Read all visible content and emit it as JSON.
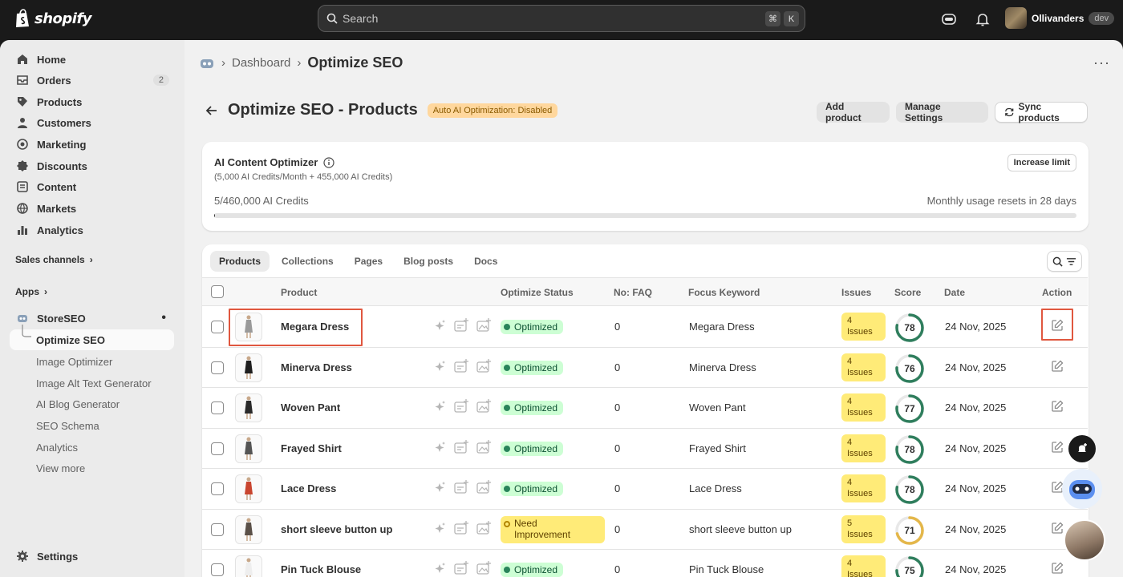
{
  "topbar": {
    "brand": "shopify",
    "search_placeholder": "Search",
    "shortcut_keys": [
      "⌘",
      "K"
    ],
    "store_name": "Ollivanders",
    "store_badge": "dev"
  },
  "sidebar": {
    "items": [
      {
        "label": "Home",
        "icon": "home-icon"
      },
      {
        "label": "Orders",
        "icon": "orders-icon",
        "count": "2"
      },
      {
        "label": "Products",
        "icon": "products-icon"
      },
      {
        "label": "Customers",
        "icon": "customers-icon"
      },
      {
        "label": "Marketing",
        "icon": "marketing-icon"
      },
      {
        "label": "Discounts",
        "icon": "discounts-icon"
      },
      {
        "label": "Content",
        "icon": "content-icon"
      },
      {
        "label": "Markets",
        "icon": "markets-icon"
      },
      {
        "label": "Analytics",
        "icon": "analytics-icon"
      }
    ],
    "sales_channels": "Sales channels",
    "apps": "Apps",
    "app_name": "StoreSEO",
    "app_sub_items": [
      "Optimize SEO",
      "Image Optimizer",
      "Image Alt Text Generator",
      "AI Blog Generator",
      "SEO Schema",
      "Analytics",
      "View more"
    ],
    "settings": "Settings"
  },
  "breadcrumb": {
    "parent": "Dashboard",
    "current": "Optimize SEO"
  },
  "page": {
    "title": "Optimize SEO - Products",
    "auto_badge": "Auto AI Optimization: Disabled",
    "add_product": "Add product",
    "manage_settings": "Manage Settings",
    "sync_products": "Sync products"
  },
  "credits": {
    "title": "AI Content Optimizer",
    "subtitle": "(5,000 AI Credits/Month + 455,000 AI Credits)",
    "used": "5/460,000 AI Credits",
    "reset": "Monthly usage resets in 28 days",
    "increase": "Increase limit",
    "used_fraction": 1.09e-05
  },
  "tabs": [
    "Products",
    "Collections",
    "Pages",
    "Blog posts",
    "Docs"
  ],
  "table": {
    "headers": {
      "product": "Product",
      "status": "Optimize Status",
      "faq": "No: FAQ",
      "keyword": "Focus Keyword",
      "issues": "Issues",
      "score": "Score",
      "date": "Date",
      "action": "Action"
    },
    "rows": [
      {
        "name": "Megara Dress",
        "status": "Optimized",
        "faq": "0",
        "keyword": "Megara Dress",
        "issues_n": "4",
        "issues_l": "Issues",
        "score": 78,
        "date": "24 Nov, 2025"
      },
      {
        "name": "Minerva Dress",
        "status": "Optimized",
        "faq": "0",
        "keyword": "Minerva Dress",
        "issues_n": "4",
        "issues_l": "Issues",
        "score": 76,
        "date": "24 Nov, 2025"
      },
      {
        "name": "Woven Pant",
        "status": "Optimized",
        "faq": "0",
        "keyword": "Woven Pant",
        "issues_n": "4",
        "issues_l": "Issues",
        "score": 77,
        "date": "24 Nov, 2025"
      },
      {
        "name": "Frayed Shirt",
        "status": "Optimized",
        "faq": "0",
        "keyword": "Frayed Shirt",
        "issues_n": "4",
        "issues_l": "Issues",
        "score": 78,
        "date": "24 Nov, 2025"
      },
      {
        "name": "Lace Dress",
        "status": "Optimized",
        "faq": "0",
        "keyword": "Lace Dress",
        "issues_n": "4",
        "issues_l": "Issues",
        "score": 78,
        "date": "24 Nov, 2025"
      },
      {
        "name": "short sleeve button up",
        "status_l1": "Need",
        "status_l2": "Improvement",
        "faq": "0",
        "keyword": "short sleeve button up",
        "issues_n": "5",
        "issues_l": "Issues",
        "score": 71,
        "date": "24 Nov, 2025"
      },
      {
        "name": "Pin Tuck Blouse",
        "status": "Optimized",
        "faq": "0",
        "keyword": "Pin Tuck Blouse",
        "issues_n": "4",
        "issues_l": "Issues",
        "score": 75,
        "date": "24 Nov, 2025"
      }
    ]
  },
  "colors": {
    "score_good": "#2f7e5d",
    "score_warn": "#e4b74a",
    "highlight": "#e0573f"
  }
}
